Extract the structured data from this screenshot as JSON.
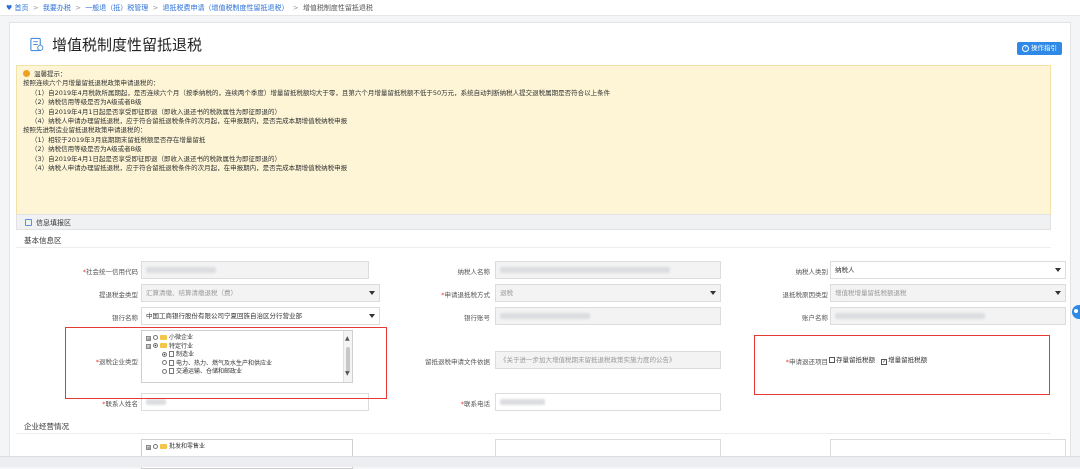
{
  "breadcrumb": {
    "items": [
      "首页",
      "我要办税",
      "一般退（抵）税管理",
      "退抵税费申请（增值税制度性留抵退税）",
      "增值税制度性留抵退税"
    ],
    "separator": ">"
  },
  "page": {
    "title": "增值税制度性留抵退税",
    "help_button": "操作指引"
  },
  "notice": {
    "heading": "温馨提示：",
    "lines": [
      "按照连续六个月增量留抵退税政策申请退税的：",
      "（1）自2019年4月税款所属期起，是否连续六个月（按季纳税的，连续两个季度）增量留抵税额均大于零，且第六个月增量留抵税额不低于50万元，系统自动判断纳税人提交退税属期是否符合以上条件",
      "（2）纳税信用等级是否为A级或者B级",
      "（3）自2019年4月1日起是否享受即征即退（即收入退还书的税款属性为即征即退的）",
      "（4）纳税人申请办理留抵退税，应于符合留抵退税条件的次月起，在申报期内，是否完成本期增值税纳税申报",
      "按照先进制造业留抵退税政策申请退税的：",
      "（1）相较于2019年3月底期期末留抵税额是否存在增量留抵",
      "（2）纳税信用等级是否为A级或者B级",
      "（3）自2019年4月1日起是否享受即征即退（即收入退还书的税款属性为即征即退的）",
      "（4）纳税人申请办理留抵退税，应于符合留抵退税条件的次月起，在申报期内，是否完成本期增值税纳税申报"
    ]
  },
  "form": {
    "section_title": "信息填报区",
    "basic_title": "基本信息区",
    "business_title": "企业经营情况",
    "fields": {
      "credit_code": {
        "label": "社会统一信用代码",
        "required": "*"
      },
      "taxpayer_name": {
        "label": "纳税人名称"
      },
      "taxpayer_type": {
        "label": "纳税人类别",
        "value": "纳税人"
      },
      "refund_tax_type": {
        "label": "提退税金类型",
        "value": "汇算清缴、结算清缴退税（费）"
      },
      "refund_method": {
        "label": "申请退抵税方式",
        "required": "*",
        "value": "退税"
      },
      "refund_reason": {
        "label": "退抵税原因类型",
        "value": "增值税增量留抵税额退税"
      },
      "bank_name": {
        "label": "银行名称",
        "value": "中国工商银行股份有限公司宁夏回族自治区分行营业部"
      },
      "bank_account": {
        "label": "银行账号"
      },
      "account_name": {
        "label": "账户名称"
      },
      "enterprise_type": {
        "label": "退税企业类型",
        "required": "*"
      },
      "policy_doc": {
        "label": "留抵退税申请文件依据",
        "value": "《关于进一步加大增值税期末留抵退税政策实施力度的公告》"
      },
      "refund_project": {
        "label": "申请退还项目",
        "required": "*",
        "option1": "存量留抵税额",
        "option2": "增量留抵税额"
      },
      "contact_name": {
        "label": "联系人姓名",
        "required": "*"
      },
      "contact_phone": {
        "label": "联系电话",
        "required": "*"
      }
    },
    "tree": [
      {
        "label": "小微企业",
        "check": "⊞",
        "selected": false,
        "kind": "folder",
        "level": 0
      },
      {
        "label": "特定行业",
        "check": "⊟",
        "selected": true,
        "kind": "folder",
        "level": 0
      },
      {
        "label": "制造业",
        "check": "",
        "selected": true,
        "kind": "page",
        "level": 1
      },
      {
        "label": "电力、热力、燃气及水生产和供应业",
        "check": "",
        "selected": false,
        "kind": "page",
        "level": 1
      },
      {
        "label": "交通运输、仓储和邮政业",
        "check": "",
        "selected": false,
        "kind": "page",
        "level": 1
      }
    ],
    "tree2": [
      {
        "label": "批发和零售业",
        "check": "⊞",
        "selected": false,
        "kind": "folder",
        "level": 0
      }
    ]
  }
}
